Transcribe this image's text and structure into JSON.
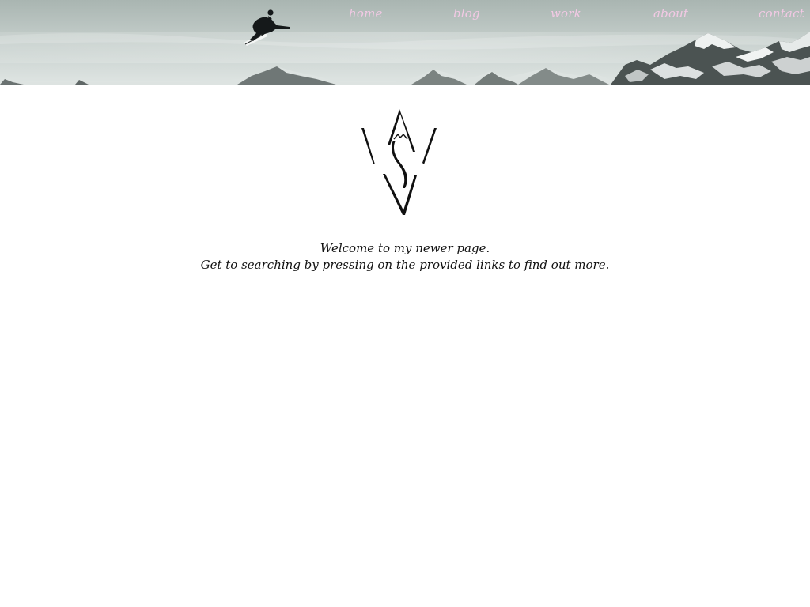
{
  "nav": {
    "items": [
      {
        "label": "home"
      },
      {
        "label": "blog"
      },
      {
        "label": "work"
      },
      {
        "label": "about"
      },
      {
        "label": "contact"
      }
    ],
    "link_color": "#f2c9e4"
  },
  "header": {
    "banner_icon": "snowboarder-mountain-banner"
  },
  "logo": {
    "icon": "vs-mountain-monogram-logo"
  },
  "welcome": {
    "line1": "Welcome to my newer page.",
    "line2": "Get to searching by pressing on the provided links to find out more."
  }
}
